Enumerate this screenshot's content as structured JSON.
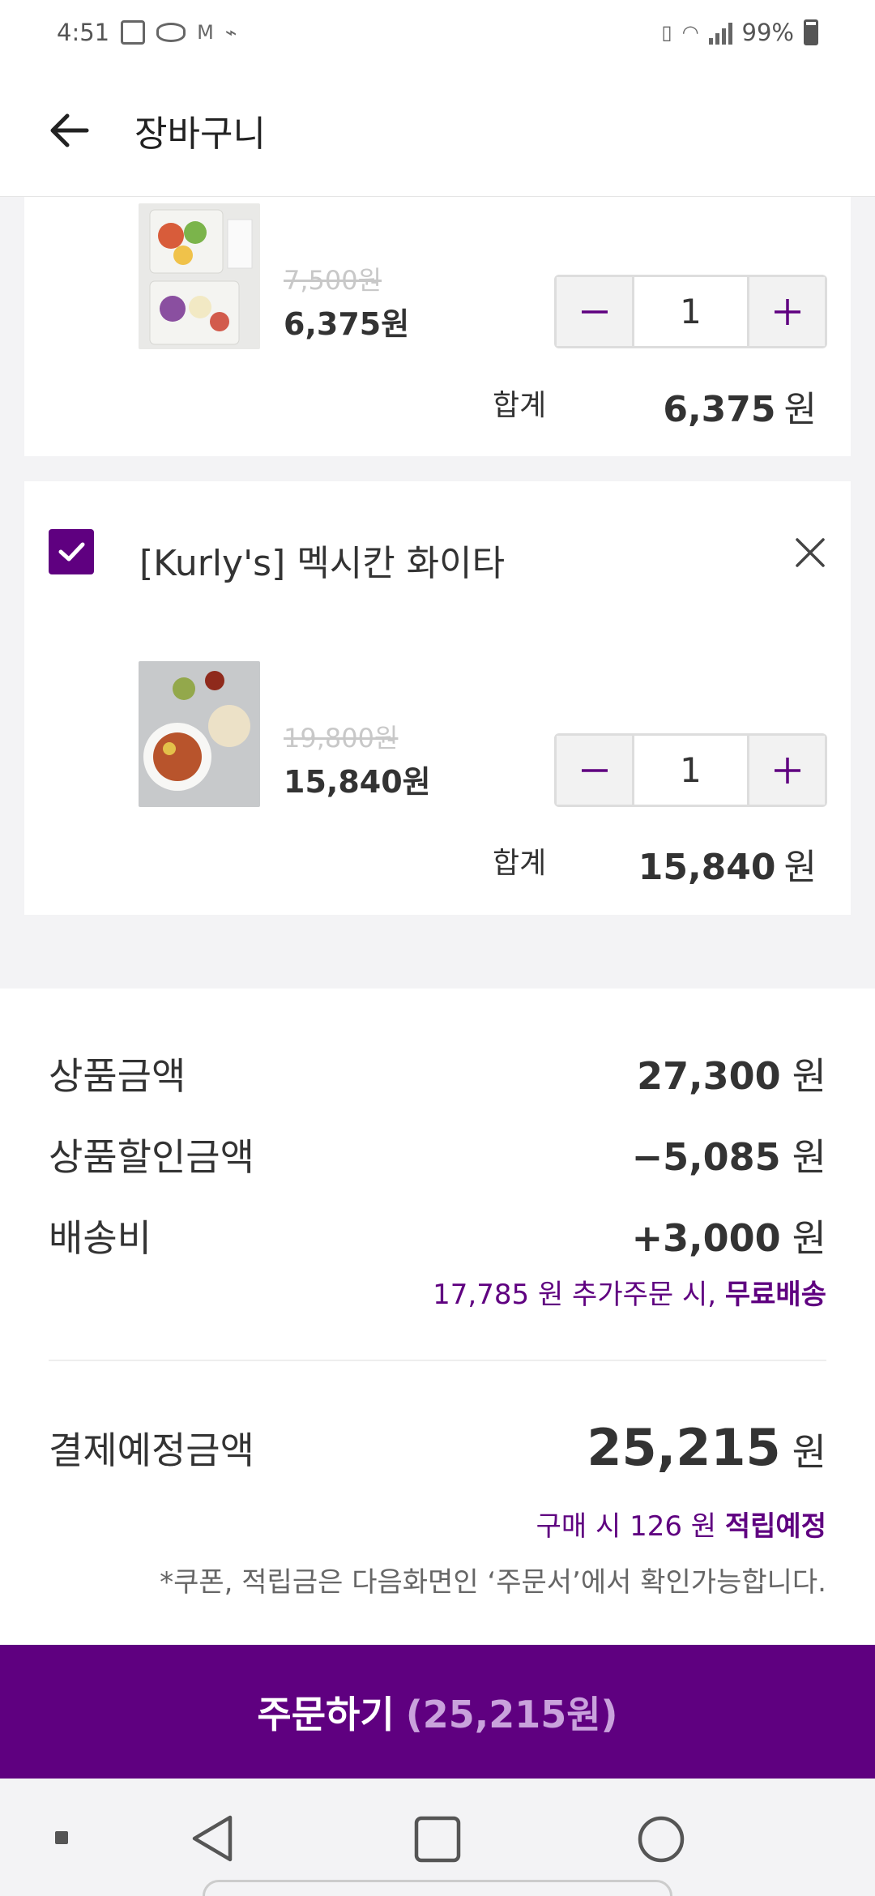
{
  "status_bar": {
    "time": "4:51",
    "battery": "99%",
    "icons": [
      "image-icon",
      "message-icon",
      "gmail-icon",
      "usb-icon",
      "vibrate-icon",
      "wifi-icon",
      "signal-icon",
      "battery-icon"
    ]
  },
  "header": {
    "title": "장바구니"
  },
  "cart": {
    "items": [
      {
        "original_price": "7,500원",
        "sale_price": "6,375원",
        "quantity": "1",
        "total_label": "합계",
        "total_value": "6,375",
        "unit": "원"
      },
      {
        "checked": true,
        "title": "[Kurly's] 멕시칸 화이타",
        "original_price": "19,800원",
        "sale_price": "15,840원",
        "quantity": "1",
        "total_label": "합계",
        "total_value": "15,840",
        "unit": "원"
      }
    ]
  },
  "summary": {
    "product_amount_label": "상품금액",
    "product_amount_value": "27,300",
    "discount_label": "상품할인금액",
    "discount_value": "−5,085",
    "shipping_label": "배송비",
    "shipping_value": "+3,000",
    "unit": "원",
    "free_shipping_note_prefix": "17,785 원 추가주문 시,",
    "free_shipping_note_bold": "무료배송",
    "payment_label": "결제예정금액",
    "payment_value": "25,215",
    "points_note_prefix": "구매 시 126 원",
    "points_note_bold": "적립예정",
    "disclaimer": "*쿠폰, 적립금은 다음화면인 ‘주문서’에서 확인가능합니다."
  },
  "order_button": {
    "label": "주문하기",
    "total": "(25,215원)"
  },
  "colors": {
    "brand": "#5f0080",
    "brand_light": "#c9a2dc"
  }
}
